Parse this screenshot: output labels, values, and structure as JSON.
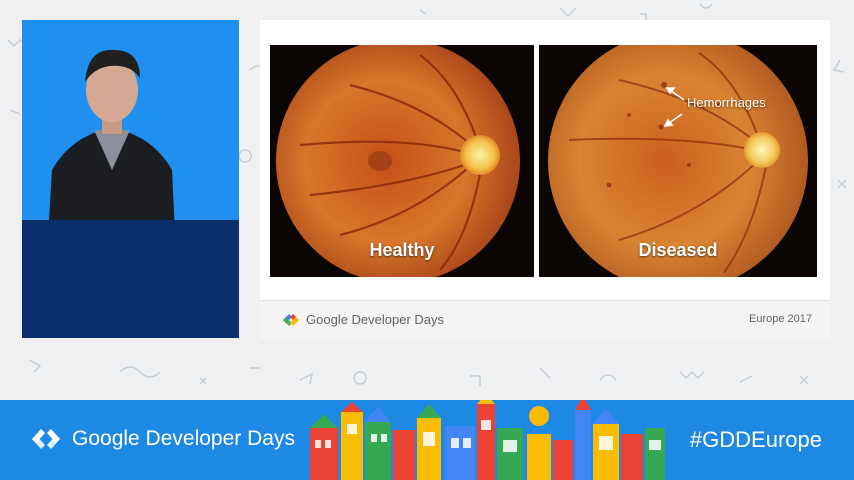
{
  "slide": {
    "left_caption": "Healthy",
    "right_caption": "Diseased",
    "annotation": "Hemorrhages",
    "footer_brand": "Google Developer Days",
    "footer_event": "Europe 2017"
  },
  "banner": {
    "brand": "Google Developer Days",
    "hashtag": "#GDDEurope"
  },
  "colors": {
    "banner_blue": "#1e88e5",
    "brand_blue": "#4285f4",
    "brand_green": "#34a853",
    "brand_yellow": "#fbbc05",
    "brand_red": "#ea4335"
  }
}
